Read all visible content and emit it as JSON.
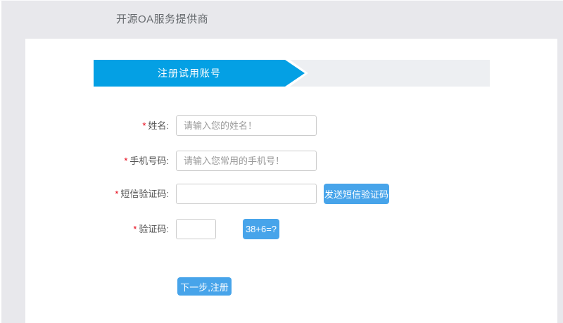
{
  "header": {
    "brand": "开源OA服务提供商"
  },
  "banner": {
    "title": "注册试用账号"
  },
  "form": {
    "fields": [
      {
        "required_mark": "*",
        "label": "姓名:",
        "placeholder": "请输入您的姓名！",
        "value": ""
      },
      {
        "required_mark": "*",
        "label": "手机号码:",
        "placeholder": "请输入您常用的手机号！",
        "value": ""
      },
      {
        "required_mark": "*",
        "label": "短信验证码:",
        "placeholder": "",
        "value": "",
        "button_label": "发送短信验证码"
      },
      {
        "required_mark": "*",
        "label": "验证码:",
        "placeholder": "",
        "value": "",
        "captcha_label": "38+6=?"
      }
    ],
    "submit_label": "下一步,注册"
  },
  "colors": {
    "page_bg": "#e8e8ec",
    "card_bg": "#ffffff",
    "ribbon_track": "#edeff2",
    "banner_blue": "#04a0e4",
    "button_blue": "#47a4ea",
    "required_red": "#e60012",
    "label_gray": "#555555",
    "placeholder_gray": "#9a9a9a"
  }
}
